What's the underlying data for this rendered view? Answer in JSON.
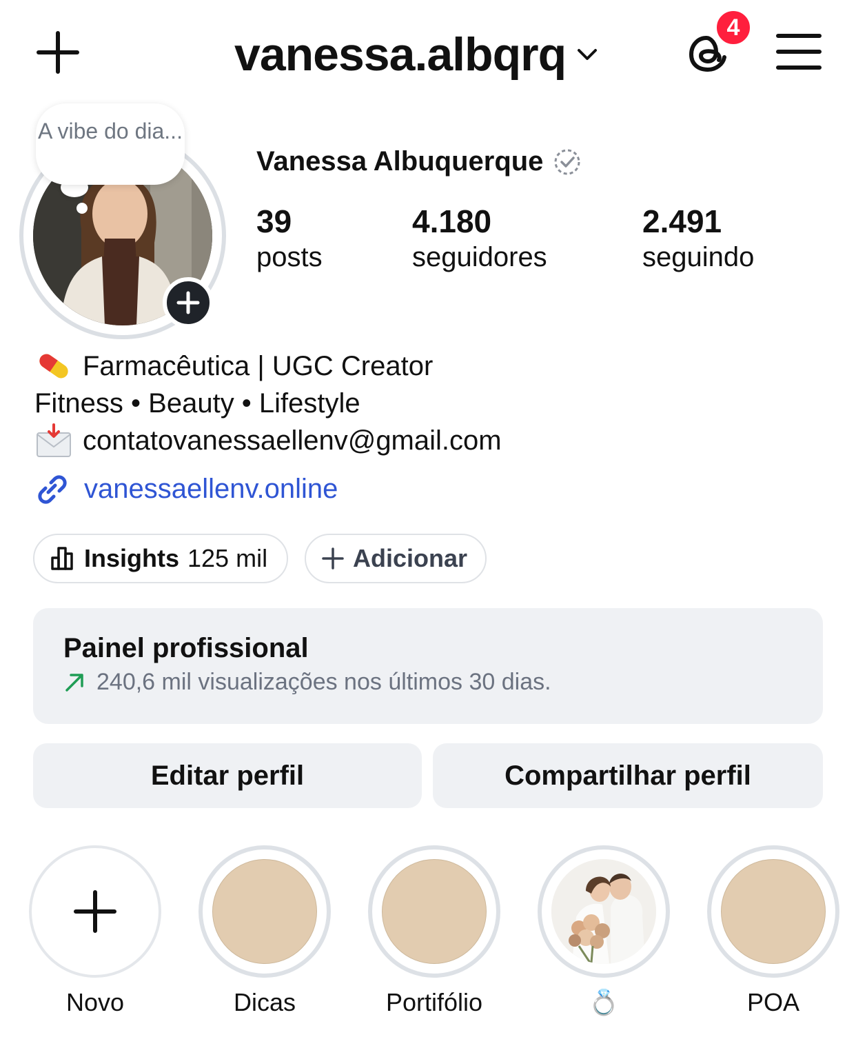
{
  "header": {
    "username": "vanessa.albqrq",
    "notification_count": "4",
    "icons": [
      "plus-icon",
      "chevron-down-icon",
      "threads-icon",
      "menu-icon"
    ]
  },
  "profile": {
    "note": "A vibe do dia...",
    "full_name": "Vanessa Albuquerque",
    "stats": {
      "posts": {
        "value": "39",
        "label": "posts"
      },
      "followers": {
        "value": "4.180",
        "label": "seguidores"
      },
      "following": {
        "value": "2.491",
        "label": "seguindo"
      }
    },
    "bio": {
      "line1": "Farmacêutica | UGC Creator",
      "line2": "Fitness • Beauty • Lifestyle",
      "line3": "contatovanessaellenv@gmail.com",
      "link": "vanessaellenv.online"
    }
  },
  "chips": {
    "insights_label": "Insights",
    "insights_value": "125 mil",
    "add_label": "Adicionar"
  },
  "dashboard": {
    "title": "Painel profissional",
    "subtitle": "240,6 mil visualizações nos últimos 30 dias."
  },
  "buttons": {
    "edit": "Editar perfil",
    "share": "Compartilhar perfil"
  },
  "highlights": [
    {
      "label": "Novo"
    },
    {
      "label": "Dicas"
    },
    {
      "label": "Portifólio"
    },
    {
      "label": "💍"
    },
    {
      "label": "POA"
    }
  ],
  "colors": {
    "link": "#2f55d4",
    "badge": "#ff1f3d",
    "panel_bg": "#eff1f4",
    "highlight_cover": "#e2ccb0",
    "trend_arrow": "#1f9d55"
  }
}
